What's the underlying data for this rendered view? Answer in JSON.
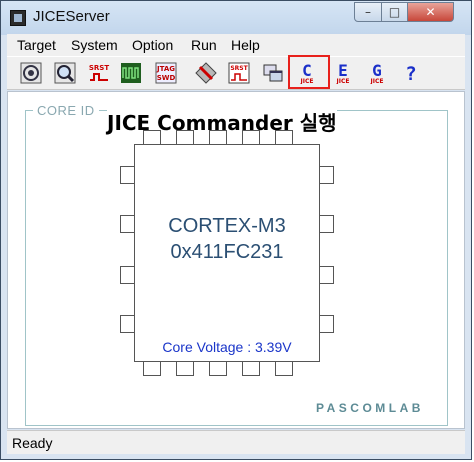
{
  "window": {
    "title": "JICEServer"
  },
  "menu": [
    "Target",
    "System",
    "Option",
    "Run",
    "Help"
  ],
  "toolbar": {
    "buttons": [
      {
        "icon": "target-connect-icon"
      },
      {
        "icon": "magnify-icon"
      },
      {
        "icon": "srst-reset-icon",
        "text": "SRST"
      },
      {
        "icon": "signal-icon"
      },
      {
        "icon": "jtag-swd-icon",
        "text": "JTAG SWD"
      },
      {
        "icon": "erase-icon"
      },
      {
        "icon": "srst-window-icon",
        "text": "SRST"
      },
      {
        "icon": "windows-icon"
      },
      {
        "icon": "jice-commander-icon",
        "letter": "C",
        "text": "JICE"
      },
      {
        "icon": "jice-e-icon",
        "letter": "E",
        "text": "JICE"
      },
      {
        "icon": "jice-g-icon",
        "letter": "G",
        "text": "JICE"
      },
      {
        "icon": "help-icon",
        "letter": "?"
      }
    ]
  },
  "annotation": "JICE Commander 실행",
  "core": {
    "group_label": "CORE ID",
    "name": "CORTEX-M3",
    "id": "0x411FC231",
    "voltage": "Core Voltage : 3.39V"
  },
  "brand": "PASCOMLAB",
  "status": "Ready",
  "colors": {
    "chip_text": "#2b4f73",
    "voltage_text": "#1a35c9",
    "highlight": "#e8201b",
    "brand": "#5d8b95"
  }
}
